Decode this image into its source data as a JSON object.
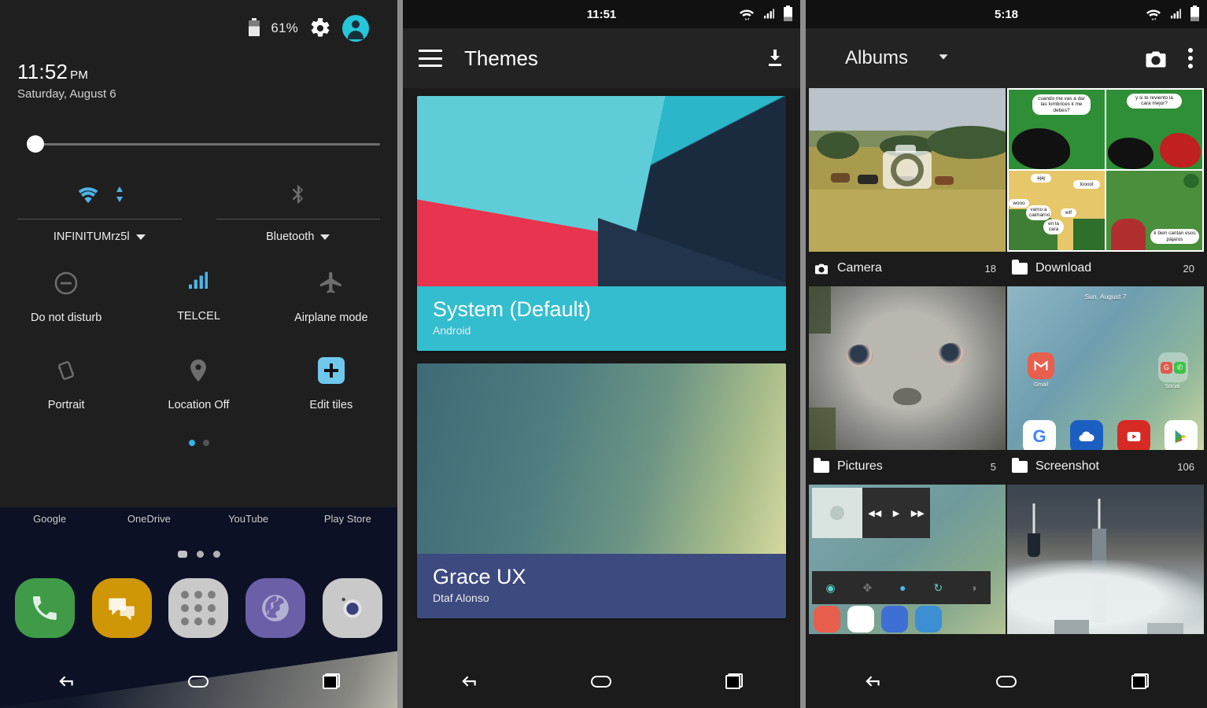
{
  "panel1": {
    "status": {
      "battery_percent": "61%",
      "battery_icon": "battery-icon",
      "settings_icon": "gear-icon",
      "user_icon": "user-avatar-icon"
    },
    "clock": {
      "time": "11:52",
      "ampm": "PM",
      "date": "Saturday, August 6"
    },
    "brightness": {
      "name": "brightness-slider",
      "value": 3
    },
    "dual_tiles": [
      {
        "label": "INFINITUMrz5l",
        "icon": "wifi-icon",
        "active": true
      },
      {
        "label": "Bluetooth",
        "icon": "bluetooth-icon",
        "active": false
      }
    ],
    "tiles_row1": [
      {
        "label": "Do not disturb",
        "icon": "do-not-disturb-icon",
        "active": false
      },
      {
        "label": "TELCEL",
        "icon": "cell-signal-icon",
        "active": true
      },
      {
        "label": "Airplane mode",
        "icon": "airplane-icon",
        "active": false
      }
    ],
    "tiles_row2": [
      {
        "label": "Portrait",
        "icon": "auto-rotate-icon",
        "active": false
      },
      {
        "label": "Location Off",
        "icon": "location-pin-icon",
        "active": false
      },
      {
        "label": "Edit tiles",
        "icon": "plus-icon",
        "active": true
      }
    ],
    "page_dots": {
      "total": 2,
      "current": 1
    },
    "home_labels": [
      "Google",
      "OneDrive",
      "YouTube",
      "Play Store"
    ],
    "home_page_dots": {
      "total": 3,
      "current": 1
    },
    "dock": [
      {
        "name": "phone-app-icon",
        "glyph": "☎"
      },
      {
        "name": "messages-app-icon",
        "glyph": ""
      },
      {
        "name": "app-drawer-icon",
        "glyph": ""
      },
      {
        "name": "browser-app-icon",
        "glyph": ""
      },
      {
        "name": "camera-app-icon",
        "glyph": ""
      }
    ],
    "navbar": [
      {
        "name": "back-button",
        "icon": "back-arrow-icon"
      },
      {
        "name": "home-button",
        "icon": "home-icon"
      },
      {
        "name": "recents-button",
        "icon": "recents-icon"
      }
    ]
  },
  "panel2": {
    "status": {
      "time": "11:51",
      "wifi_icon": "wifi-icon",
      "signal_icon": "cell-signal-icon",
      "battery_icon": "battery-icon"
    },
    "appbar": {
      "menu_icon": "hamburger-menu-icon",
      "title": "Themes",
      "download_icon": "download-icon"
    },
    "themes": [
      {
        "name": "System (Default)",
        "author": "Android"
      },
      {
        "name": "Grace UX",
        "author": "Dtaf Alonso"
      }
    ],
    "navbar": [
      {
        "name": "back-button",
        "icon": "back-arrow-icon"
      },
      {
        "name": "home-button",
        "icon": "home-icon"
      },
      {
        "name": "recents-button",
        "icon": "recents-icon"
      }
    ]
  },
  "panel3": {
    "status": {
      "time": "5:18",
      "wifi_icon": "wifi-icon",
      "signal_icon": "cell-signal-icon",
      "battery_icon": "battery-icon"
    },
    "appbar": {
      "title": "Albums",
      "dropdown_icon": "chevron-down-icon",
      "camera_icon": "camera-icon",
      "overflow_icon": "more-vertical-icon"
    },
    "albums": [
      {
        "name": "Camera",
        "count": "18",
        "icon": "camera-icon"
      },
      {
        "name": "Download",
        "count": "20",
        "icon": "folder-icon"
      },
      {
        "name": "Pictures",
        "count": "5",
        "icon": "folder-icon"
      },
      {
        "name": "Screenshot",
        "count": "106",
        "icon": "folder-icon"
      }
    ],
    "thumb_texts": {
      "comic_b1": "cuando me vas a dar las lombrices k me debes?",
      "comic_b2": "y si te reviento la cara mejor?",
      "comic_b3": "ajaj",
      "comic_b4": "looool",
      "comic_b5": "wooo",
      "comic_b6": "vamo a caimarno",
      "comic_b7": "wtf",
      "comic_b8": "en la cara",
      "comic_b9": "k bien cantan esos pájaros",
      "home_date": "Sun, August 7",
      "home_app1": "Gmail",
      "home_app2": "Social"
    },
    "navbar": [
      {
        "name": "back-button",
        "icon": "back-arrow-icon"
      },
      {
        "name": "home-button",
        "icon": "home-icon"
      },
      {
        "name": "recents-button",
        "icon": "recents-icon"
      }
    ]
  },
  "colors": {
    "accent_cyan": "#26c6da",
    "tile_active": "#35b4e6",
    "theme_teal": "#34bdcf",
    "theme_navy": "#3d4a80",
    "panel_bg": "#1b1b1b",
    "divider": "#8d8d8d"
  }
}
